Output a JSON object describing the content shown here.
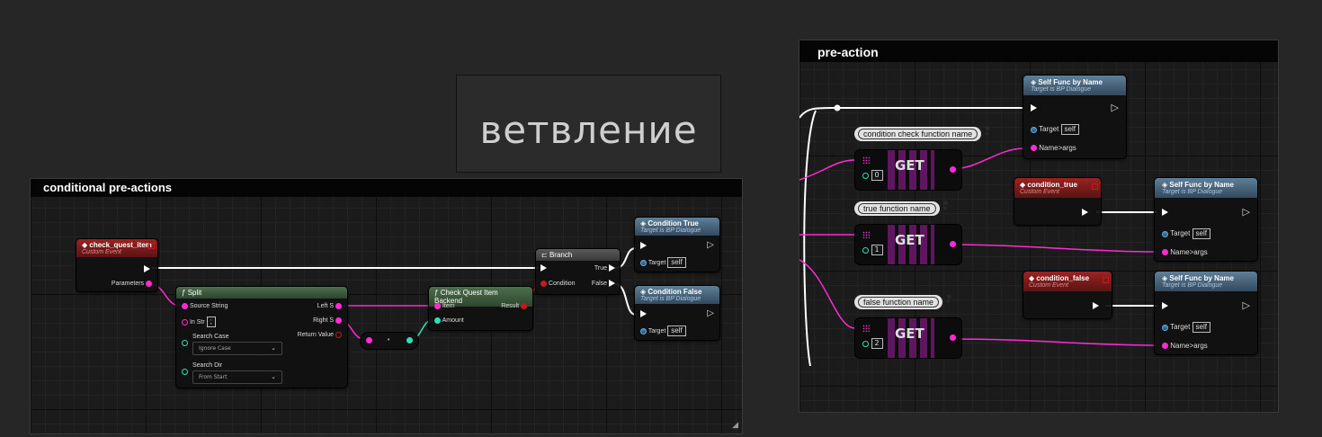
{
  "label_node": {
    "text": "ветвление"
  },
  "left_graph": {
    "title": "conditional pre-actions",
    "check_quest_item": {
      "title": "check_quest_item",
      "subtitle": "Custom Event",
      "param": "Parameters"
    },
    "split": {
      "title": "Split",
      "source": "Source String",
      "in_str": "In Str",
      "in_str_val": ";",
      "search_case": "Search Case",
      "search_case_val": "Ignore Case",
      "search_dir": "Search Dir",
      "search_dir_val": "From Start",
      "left_s": "Left S",
      "right_s": "Right S",
      "return_value": "Return Value"
    },
    "backend": {
      "title": "Check Quest Item Backend",
      "item": "Item",
      "amount": "Amount",
      "result": "Result"
    },
    "branch": {
      "title": "Branch",
      "condition": "Condition",
      "true": "True",
      "false": "False"
    },
    "cond_true": {
      "title": "Condition True",
      "subtitle": "Target is BP Dialogue",
      "target": "Target",
      "self": "self"
    },
    "cond_false": {
      "title": "Condition False",
      "subtitle": "Target is BP Dialogue",
      "target": "Target",
      "self": "self"
    }
  },
  "right_graph": {
    "title": "pre-action",
    "self_func_1": {
      "title": "Self Func by Name",
      "subtitle": "Target is BP Dialogue",
      "target": "Target",
      "self": "self",
      "name_args": "Name>args"
    },
    "self_func_2": {
      "title": "Self Func by Name",
      "subtitle": "Target is BP Dialogue",
      "target": "Target",
      "self": "self",
      "name_args": "Name>args"
    },
    "self_func_3": {
      "title": "Self Func by Name",
      "subtitle": "Target is BP Dialogue",
      "target": "Target",
      "self": "self",
      "name_args": "Name>args"
    },
    "comment_1": "condition check function name",
    "comment_2": "true function name",
    "comment_3": "false function name",
    "get_1": {
      "label": "GET",
      "index": "0"
    },
    "get_2": {
      "label": "GET",
      "index": "1"
    },
    "get_3": {
      "label": "GET",
      "index": "2"
    },
    "cond_true_event": {
      "title": "condition_true",
      "subtitle": "Custom Event"
    },
    "cond_false_event": {
      "title": "condition_false",
      "subtitle": "Custom Event"
    }
  },
  "colors": {
    "string_pin": "#ff2bd4",
    "int_pin": "#2fe0b3",
    "exec": "#ffffff",
    "event_header": "#9b2222",
    "function_header": "#5e7f99"
  }
}
